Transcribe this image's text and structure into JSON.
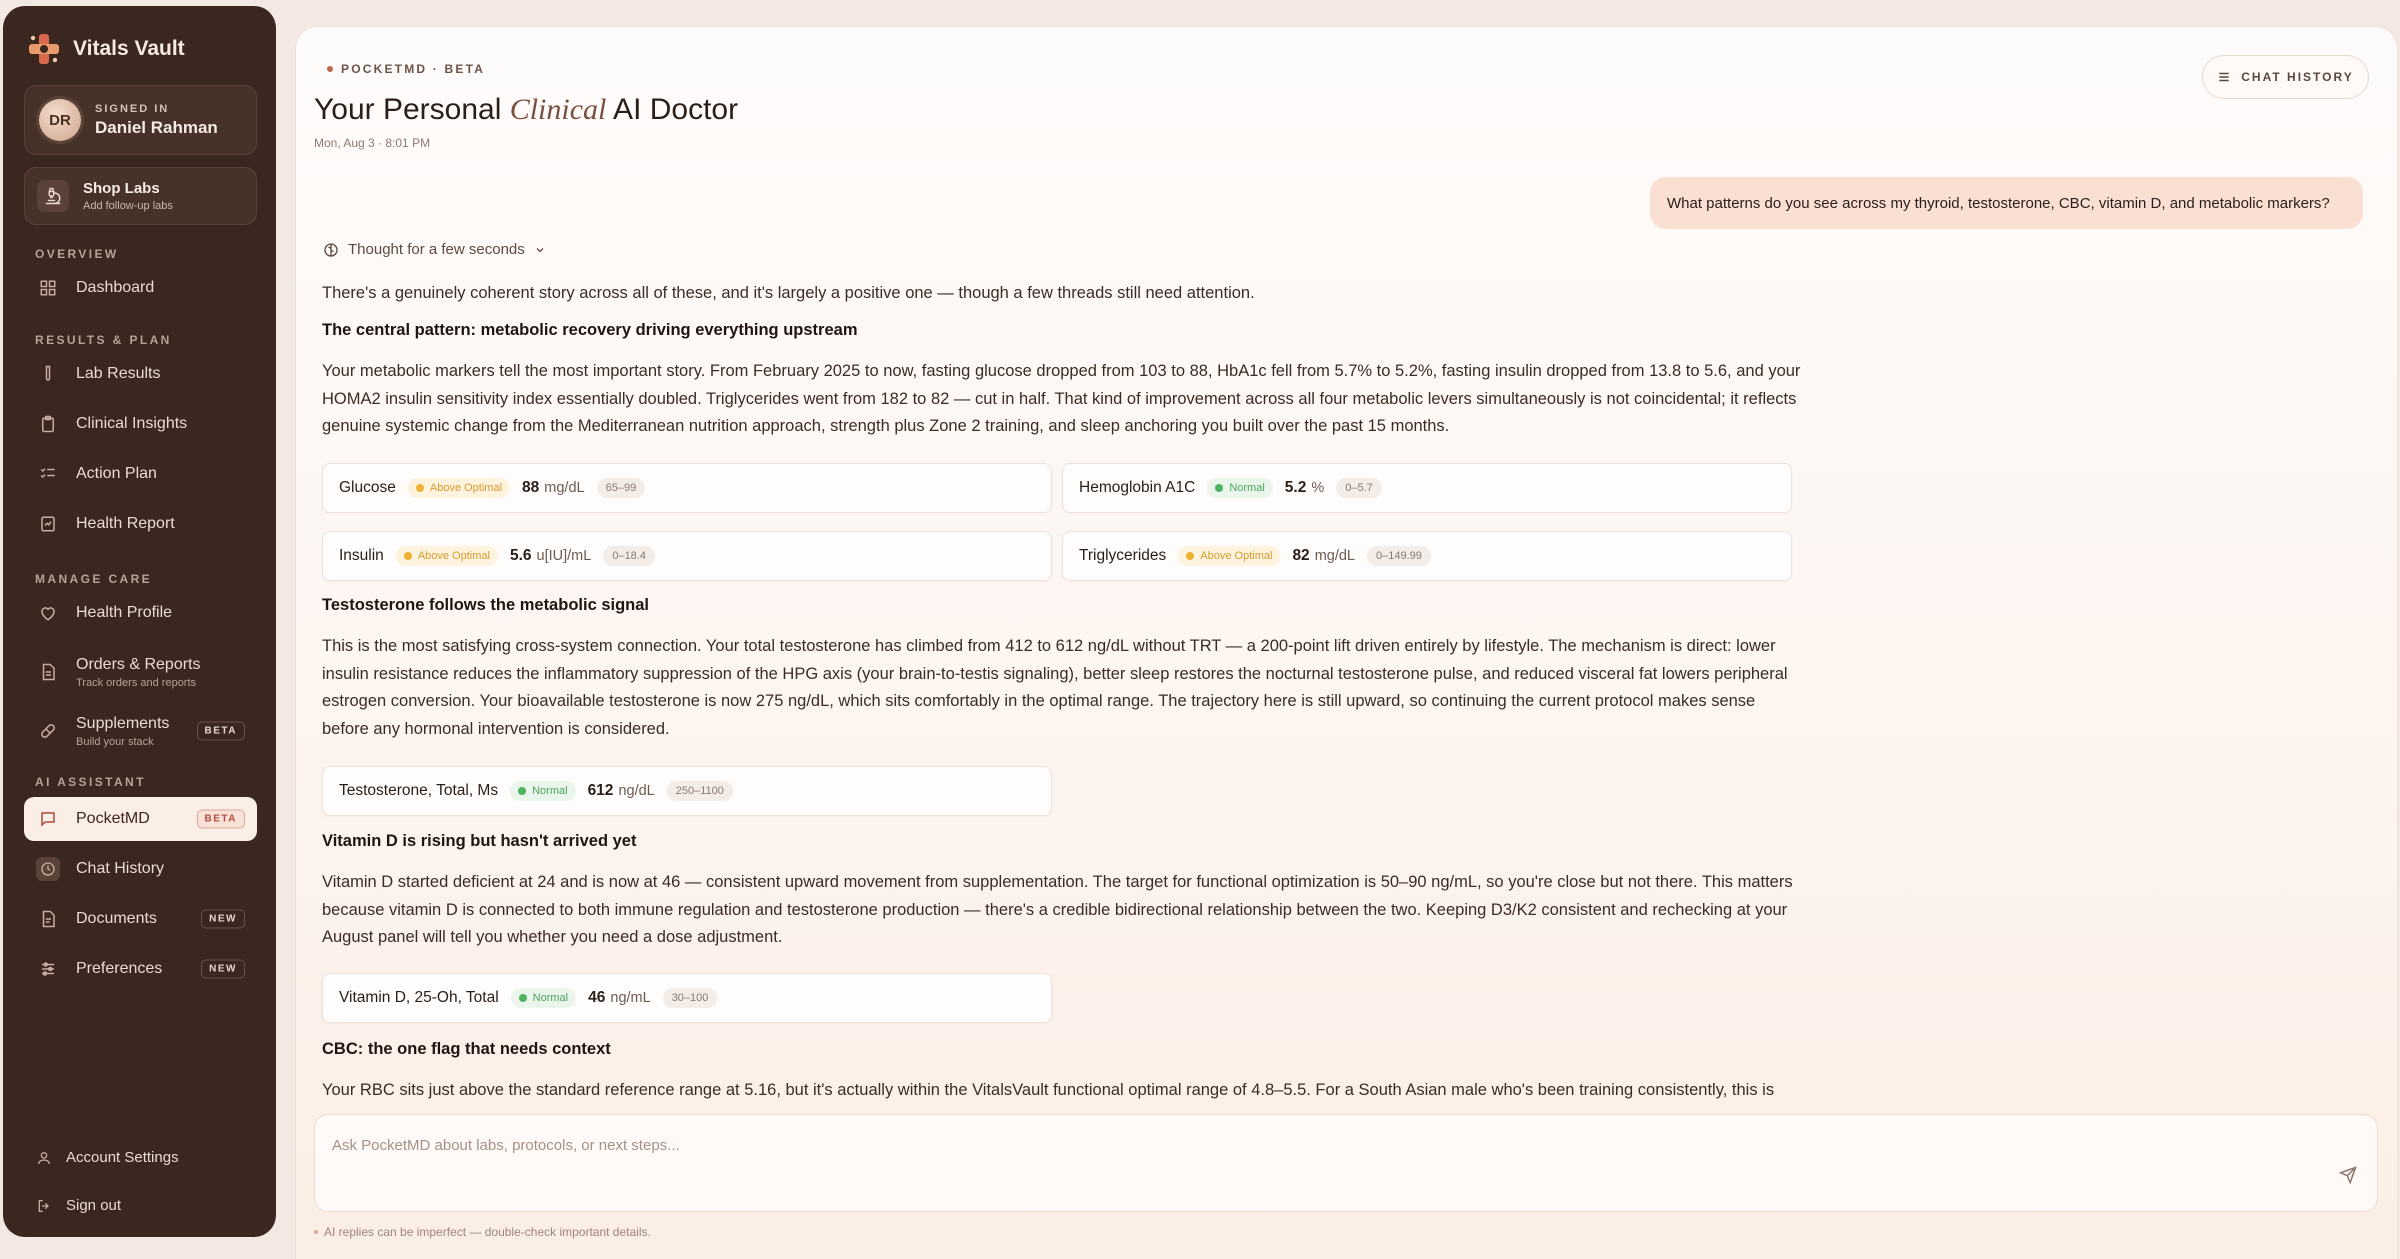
{
  "sidebar": {
    "brand": "Vitals Vault",
    "user": {
      "signed_in_label": "SIGNED IN",
      "name": "Daniel Rahman",
      "initials": "DR"
    },
    "shop": {
      "title": "Shop Labs",
      "subtitle": "Add follow-up labs"
    },
    "sections": {
      "overview": "OVERVIEW",
      "results_plan": "RESULTS & PLAN",
      "manage_care": "MANAGE CARE",
      "ai_assistant": "AI ASSISTANT"
    },
    "items": {
      "dashboard": "Dashboard",
      "lab_results": "Lab Results",
      "clinical_insights": "Clinical Insights",
      "action_plan": "Action Plan",
      "health_report": "Health Report",
      "health_profile": "Health Profile",
      "orders": {
        "label": "Orders & Reports",
        "sub": "Track orders and reports"
      },
      "supplements": {
        "label": "Supplements",
        "sub": "Build your stack",
        "badge": "BETA"
      },
      "pocketmd": {
        "label": "PocketMD",
        "badge": "BETA"
      },
      "chat_history": "Chat History",
      "documents": {
        "label": "Documents",
        "badge": "NEW"
      },
      "preferences": {
        "label": "Preferences",
        "badge": "NEW"
      }
    },
    "footer": {
      "account_settings": "Account Settings",
      "sign_out": "Sign out"
    }
  },
  "header": {
    "kicker": "POCKETMD · BETA",
    "title_pre": "Your Personal ",
    "title_italic": "Clinical",
    "title_post": " AI Doctor",
    "timestamp": "Mon, Aug 3 · 8:01 PM",
    "chat_history_button": "CHAT HISTORY"
  },
  "conversation": {
    "user_message": "What patterns do you see across my thyroid, testosterone, CBC, vitamin D, and metabolic markers?",
    "thought_label": "Thought for a few seconds",
    "intro": "There's a genuinely coherent story across all of these, and it's largely a positive one — though a few threads still need attention.",
    "h1": "The central pattern: metabolic recovery driving everything upstream",
    "p1": "Your metabolic markers tell the most important story. From February 2025 to now, fasting glucose dropped from 103 to 88, HbA1c fell from 5.7% to 5.2%, fasting insulin dropped from 13.8 to 5.6, and your HOMA2 insulin sensitivity index essentially doubled. Triglycerides went from 182 to 82 — cut in half. That kind of improvement across all four metabolic levers simultaneously is not coincidental; it reflects genuine systemic change from the Mediterranean nutrition approach, strength plus Zone 2 training, and sleep anchoring you built over the past 15 months.",
    "metabolic_cards": [
      {
        "name": "Glucose",
        "status": "Above Optimal",
        "status_type": "warn",
        "value": "88",
        "unit": "mg/dL",
        "range": "65–99"
      },
      {
        "name": "Hemoglobin A1C",
        "status": "Normal",
        "status_type": "ok",
        "value": "5.2",
        "unit": "%",
        "range": "0–5.7"
      },
      {
        "name": "Insulin",
        "status": "Above Optimal",
        "status_type": "warn",
        "value": "5.6",
        "unit": "u[IU]/mL",
        "range": "0–18.4"
      },
      {
        "name": "Triglycerides",
        "status": "Above Optimal",
        "status_type": "warn",
        "value": "82",
        "unit": "mg/dL",
        "range": "0–149.99"
      }
    ],
    "h2": "Testosterone follows the metabolic signal",
    "p2": "This is the most satisfying cross-system connection. Your total testosterone has climbed from 412 to 612 ng/dL without TRT — a 200-point lift driven entirely by lifestyle. The mechanism is direct: lower insulin resistance reduces the inflammatory suppression of the HPG axis (your brain-to-testis signaling), better sleep restores the nocturnal testosterone pulse, and reduced visceral fat lowers peripheral estrogen conversion. Your bioavailable testosterone is now 275 ng/dL, which sits comfortably in the optimal range. The trajectory here is still upward, so continuing the current protocol makes sense before any hormonal intervention is considered.",
    "testosterone_card": {
      "name": "Testosterone, Total, Ms",
      "status": "Normal",
      "status_type": "ok",
      "value": "612",
      "unit": "ng/dL",
      "range": "250–1100"
    },
    "h3": "Vitamin D is rising but hasn't arrived yet",
    "p3": "Vitamin D started deficient at 24 and is now at 46 — consistent upward movement from supplementation. The target for functional optimization is 50–90 ng/mL, so you're close but not there. This matters because vitamin D is connected to both immune regulation and testosterone production — there's a credible bidirectional relationship between the two. Keeping D3/K2 consistent and rechecking at your August panel will tell you whether you need a dose adjustment.",
    "vitamin_card": {
      "name": "Vitamin D, 25-Oh, Total",
      "status": "Normal",
      "status_type": "ok",
      "value": "46",
      "unit": "ng/mL",
      "range": "30–100"
    },
    "h4": "CBC: the one flag that needs context",
    "p4": "Your RBC sits just above the standard reference range at 5.16, but it's actually within the VitalsVault functional optimal range of 4.8–5.5. For a South Asian male who's been training consistently, this is"
  },
  "composer": {
    "placeholder": "Ask PocketMD about labs, protocols, or next steps...",
    "disclaimer": "AI replies can be imperfect — double-check important details."
  }
}
